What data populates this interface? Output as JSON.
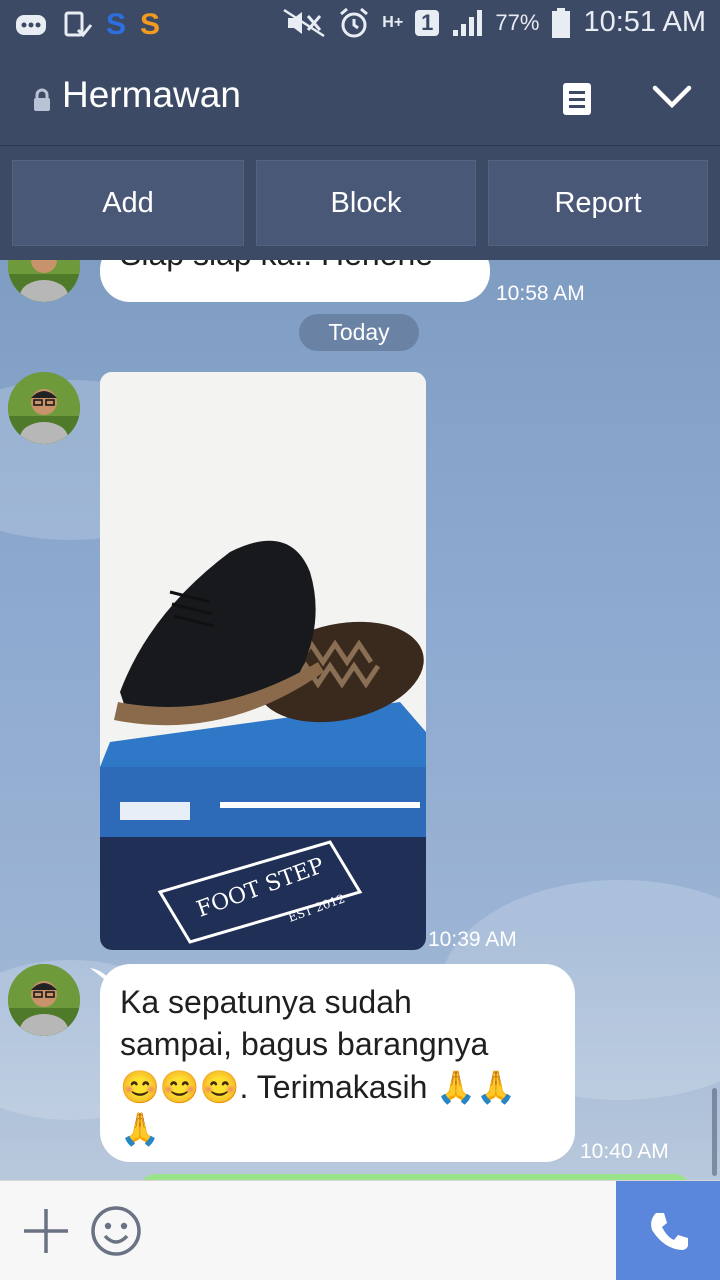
{
  "status_bar": {
    "battery": "77%",
    "time": "10:51 AM",
    "network": "H+",
    "sim": "1",
    "app_s_blue": "S",
    "app_s_orange": "S"
  },
  "header": {
    "title": "Hermawan",
    "icons": [
      "lock-icon",
      "note-icon",
      "chevron-down-icon"
    ]
  },
  "actions": {
    "add": "Add",
    "block": "Block",
    "report": "Report"
  },
  "chat": {
    "messages": [
      {
        "text": "Siap siap ka.. Hehehe",
        "time": "10:58 AM"
      },
      {
        "type": "image",
        "time": "10:39 AM",
        "image_text": "FOOT STEP",
        "image_subtext": "EST 2012"
      },
      {
        "text_line1": "Ka sepatunya sudah",
        "text_line2": "sampai, bagus barangnya",
        "text_line3": "😊😊😊. Terimakasih 🙏🙏",
        "text_line4": "🙏",
        "time": "10:40 AM"
      }
    ],
    "date_divider": "Today"
  },
  "colors": {
    "header_bg": "#3d4a66",
    "button_bg": "#4a5878",
    "call_bg": "#5a86dc",
    "date_pill_bg": "#6a82a4"
  }
}
